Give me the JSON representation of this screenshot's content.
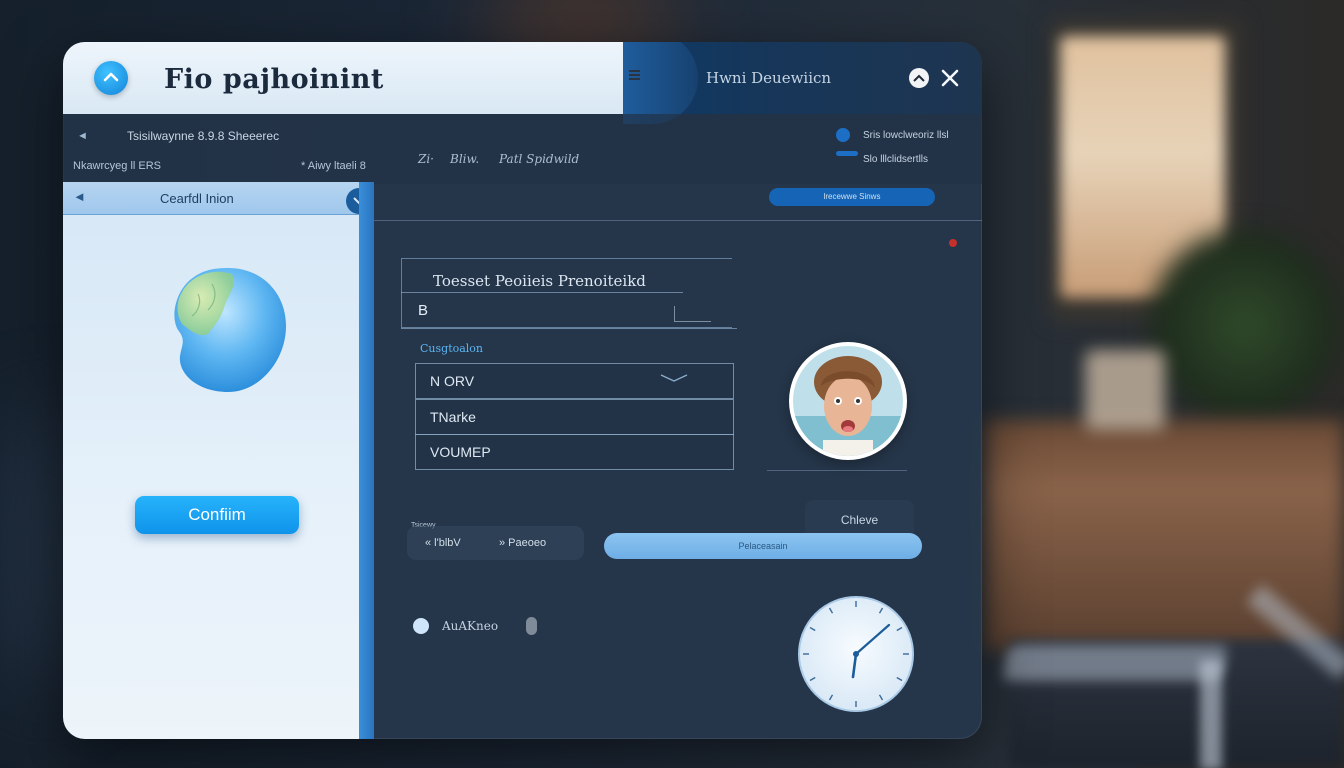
{
  "window": {
    "app_title": "Fio pajhoinint",
    "top_right_title": "Hwni Deuewiicn",
    "minimize_icon": "chevron-up-icon",
    "close_icon": "close-icon"
  },
  "subheader": {
    "back": "◄",
    "path": "Tsisilwaynne 8.9.8 Sheeerec",
    "left_row": "Nkawrcyeg ll ERS",
    "left_row_right": "* Aiwy ltaeli 8",
    "mid_items": [
      "Zi·",
      "Bliw.",
      "Patl Spidwild"
    ],
    "right_row_1": "Sris lowclweoriz llsl",
    "right_row_2": "Slo lllclidsertlls"
  },
  "left_panel": {
    "back": "◄",
    "title": "Cearfdl Inion",
    "confirm_label": "Confiim"
  },
  "content": {
    "top_pill": "lrecewwe Sinws",
    "form_title": "Toesset Peoiieis Prenoiteikd",
    "field_value": "B",
    "section_label": "Cusgtoalon",
    "options": [
      "N ORV",
      "TNarke",
      "VOUMEP"
    ],
    "ghost_button": "Chleve",
    "tiny_label": "Tsicewy",
    "input_value_1": "« l'blbV",
    "input_value_2": "» Paeoeo",
    "progress_text": "Pelaceasain",
    "radio_label": "AuAKneo"
  },
  "colors": {
    "accent": "#0e93ea",
    "dark_panel": "#26374c",
    "light_panel": "#e6f1fa"
  }
}
